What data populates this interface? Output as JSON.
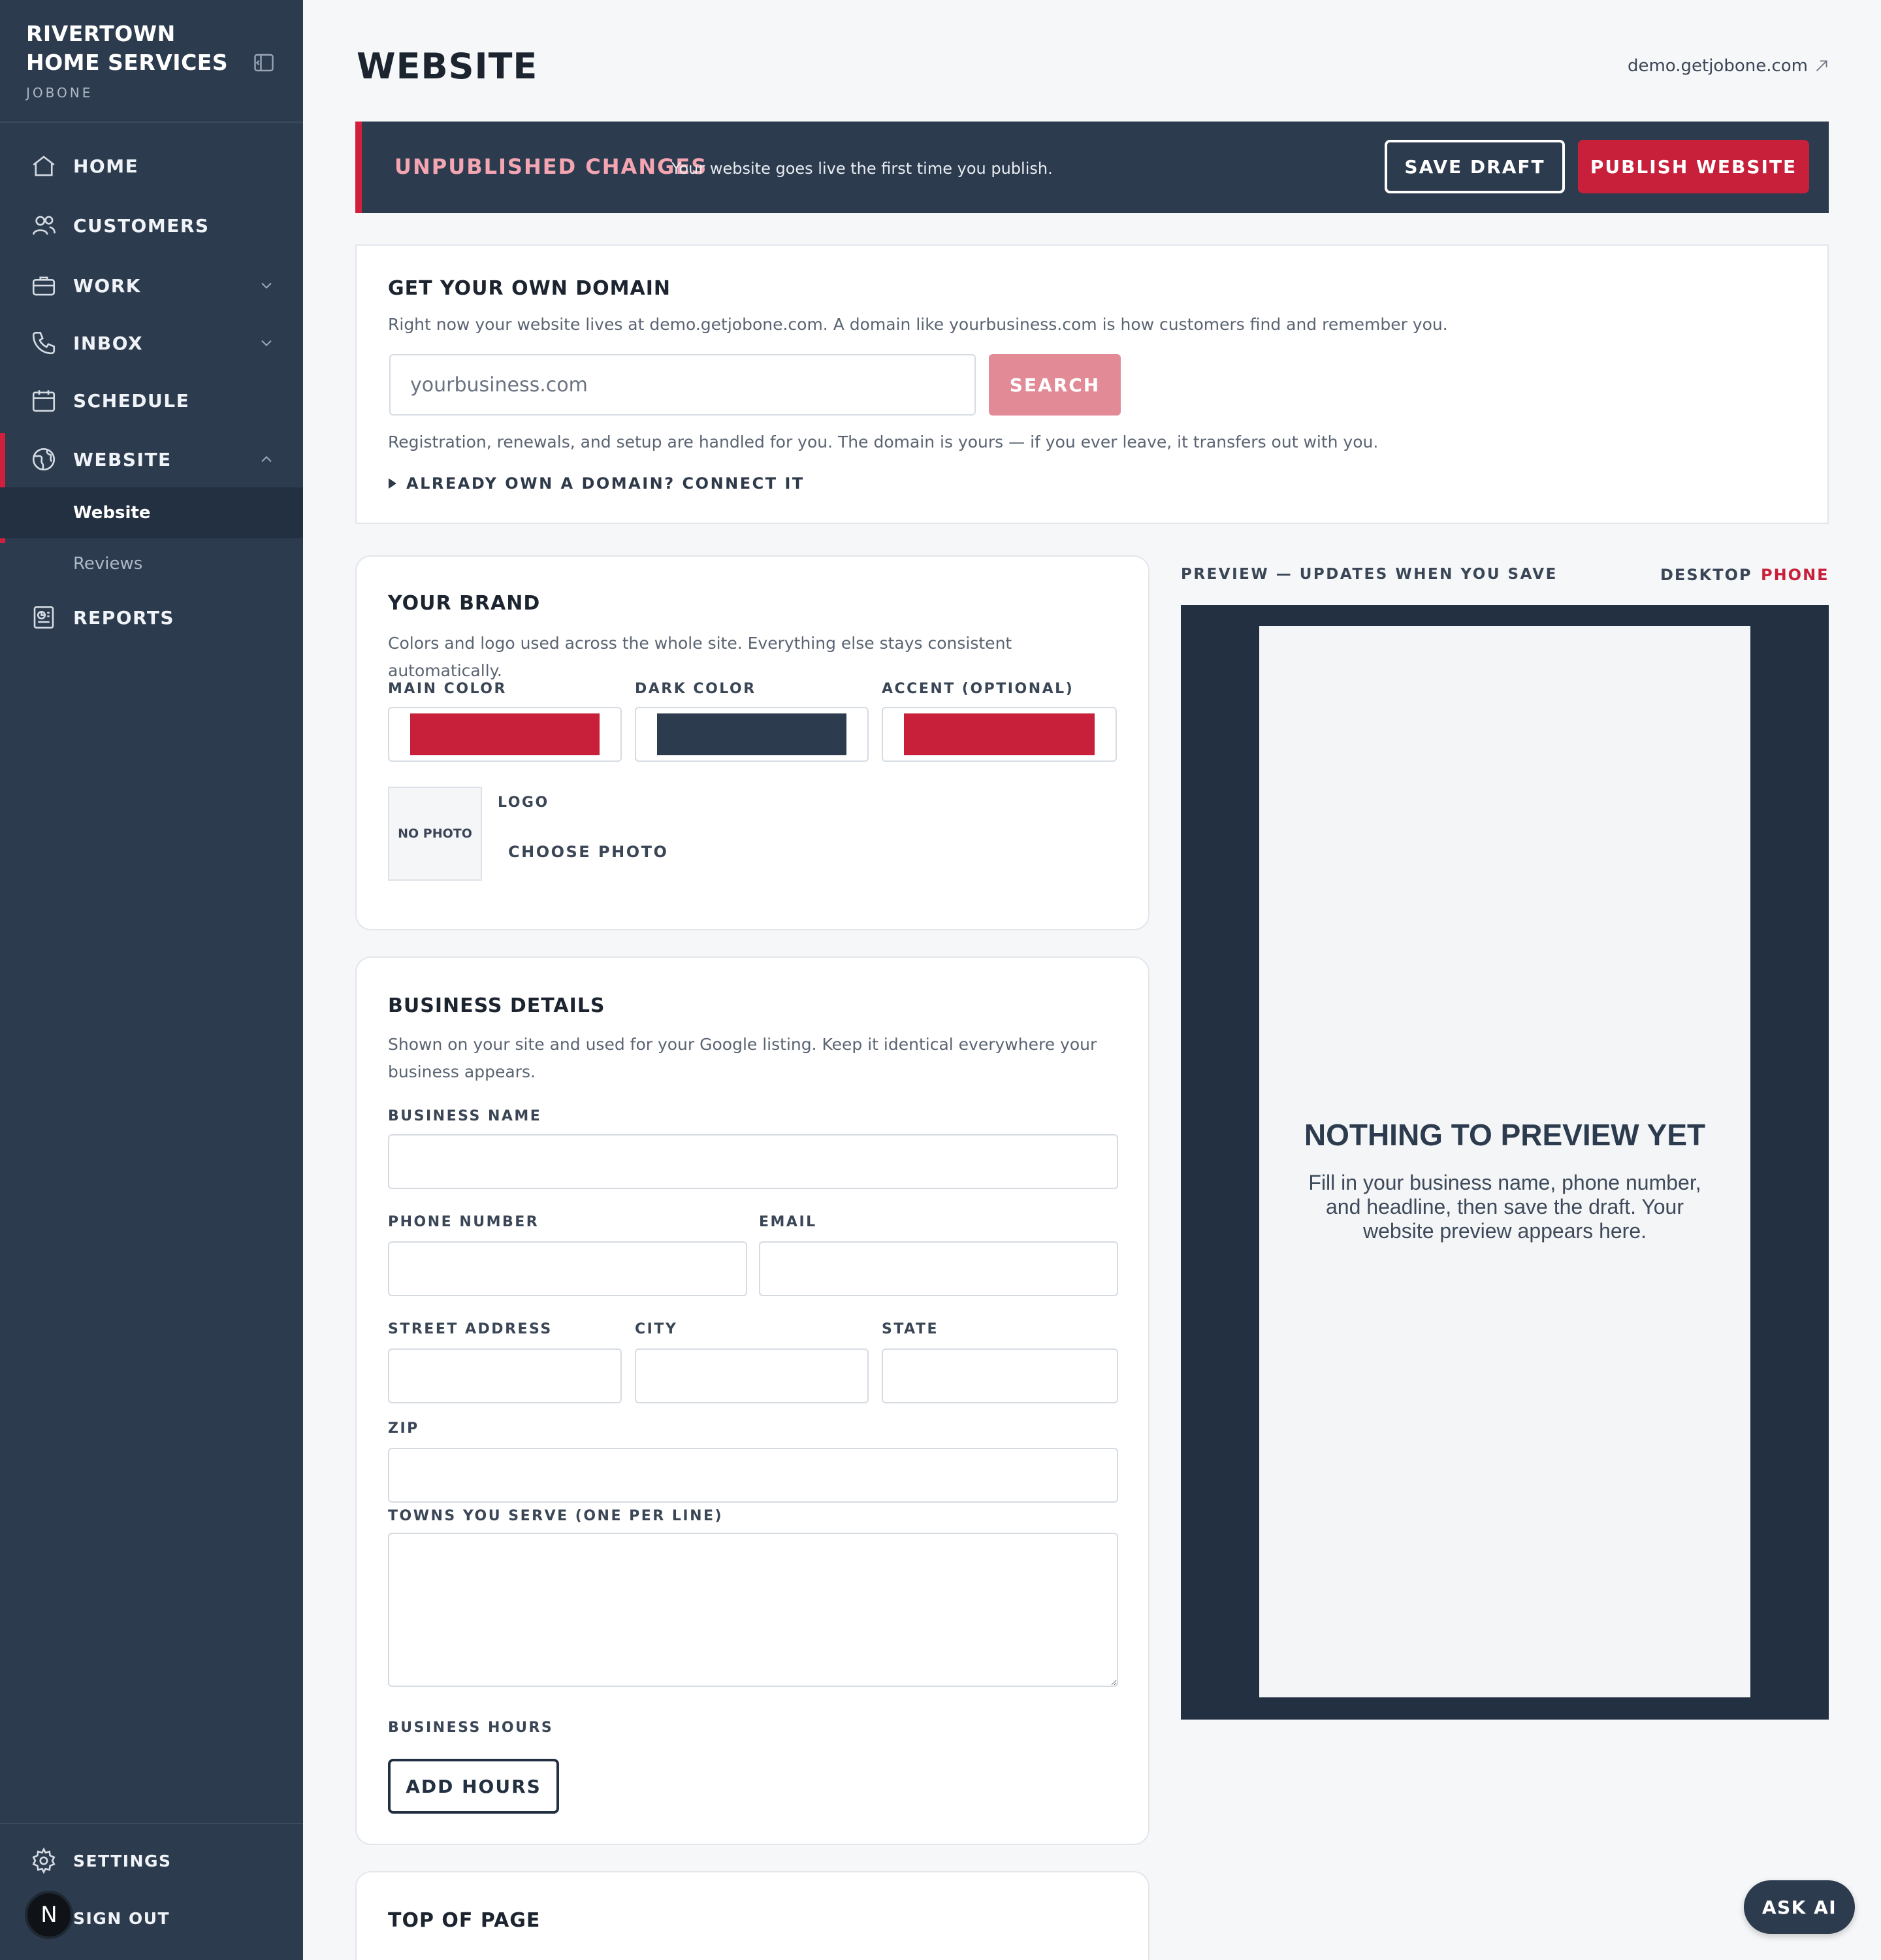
{
  "sidebar": {
    "brand_name": "RIVERTOWN HOME SERVICES",
    "brand_sub": "JOBONE",
    "items": [
      {
        "label": "HOME",
        "icon": "home-icon"
      },
      {
        "label": "CUSTOMERS",
        "icon": "users-icon"
      },
      {
        "label": "WORK",
        "icon": "briefcase-icon"
      },
      {
        "label": "INBOX",
        "icon": "phone-icon"
      },
      {
        "label": "SCHEDULE",
        "icon": "calendar-icon"
      },
      {
        "label": "WEBSITE",
        "icon": "globe-icon"
      },
      {
        "label": "REPORTS",
        "icon": "report-icon"
      }
    ],
    "subitems": [
      {
        "label": "Website"
      },
      {
        "label": "Reviews"
      }
    ],
    "settings_label": "SETTINGS",
    "signout_label": "SIGN OUT",
    "avatar_letter": "N"
  },
  "header": {
    "title": "WEBSITE",
    "site_link": "demo.getjobone.com"
  },
  "banner": {
    "title": "UNPUBLISHED CHANGES",
    "text": "Your website goes live the first time you publish.",
    "save_label": "SAVE DRAFT",
    "publish_label": "PUBLISH WEBSITE"
  },
  "domain": {
    "title": "GET YOUR OWN DOMAIN",
    "desc": "Right now your website lives at demo.getjobone.com. A domain like yourbusiness.com is how customers find and remember you.",
    "input_value": "yourbusiness.com",
    "search_label": "SEARCH",
    "note": "Registration, renewals, and setup are handled for you. The domain is yours — if you ever leave, it transfers out with you.",
    "connect_label": "ALREADY OWN A DOMAIN? CONNECT IT"
  },
  "brand": {
    "title": "YOUR BRAND",
    "desc": "Colors and logo used across the whole site. Everything else stays consistent automatically.",
    "main_label": "MAIN COLOR",
    "dark_label": "DARK COLOR",
    "accent_label": "ACCENT (OPTIONAL)",
    "colors": {
      "main": "#c8203b",
      "dark": "#2c3b4e",
      "accent": "#c8203b"
    },
    "photo_placeholder": "NO PHOTO",
    "logo_label": "LOGO",
    "choose_photo": "CHOOSE PHOTO"
  },
  "business": {
    "title": "BUSINESS DETAILS",
    "desc": "Shown on your site and used for your Google listing. Keep it identical everywhere your business appears.",
    "name_label": "BUSINESS NAME",
    "phone_label": "PHONE NUMBER",
    "email_label": "EMAIL",
    "street_label": "STREET ADDRESS",
    "city_label": "CITY",
    "state_label": "STATE",
    "zip_label": "ZIP",
    "towns_label": "TOWNS YOU SERVE (ONE PER LINE)",
    "hours_label": "BUSINESS HOURS",
    "add_hours": "ADD HOURS"
  },
  "top_of_page": {
    "title": "TOP OF PAGE"
  },
  "preview": {
    "label": "PREVIEW — UPDATES WHEN YOU SAVE",
    "desktop_tab": "DESKTOP",
    "phone_tab": "PHONE",
    "empty_title": "NOTHING TO PREVIEW YET",
    "empty_text": "Fill in your business name, phone number, and headline, then save the draft. Your website preview appears here."
  },
  "ask_ai": "ASK AI",
  "accent_color": "#c8203b"
}
